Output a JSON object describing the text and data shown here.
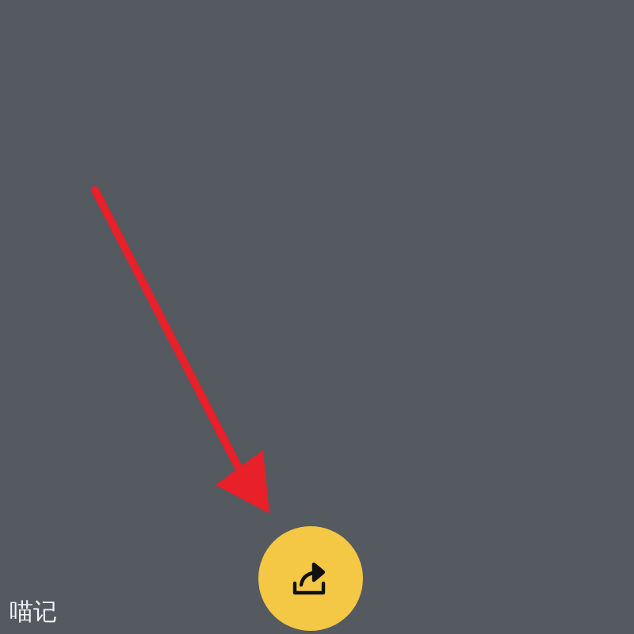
{
  "footer": {
    "label": "喵记"
  }
}
